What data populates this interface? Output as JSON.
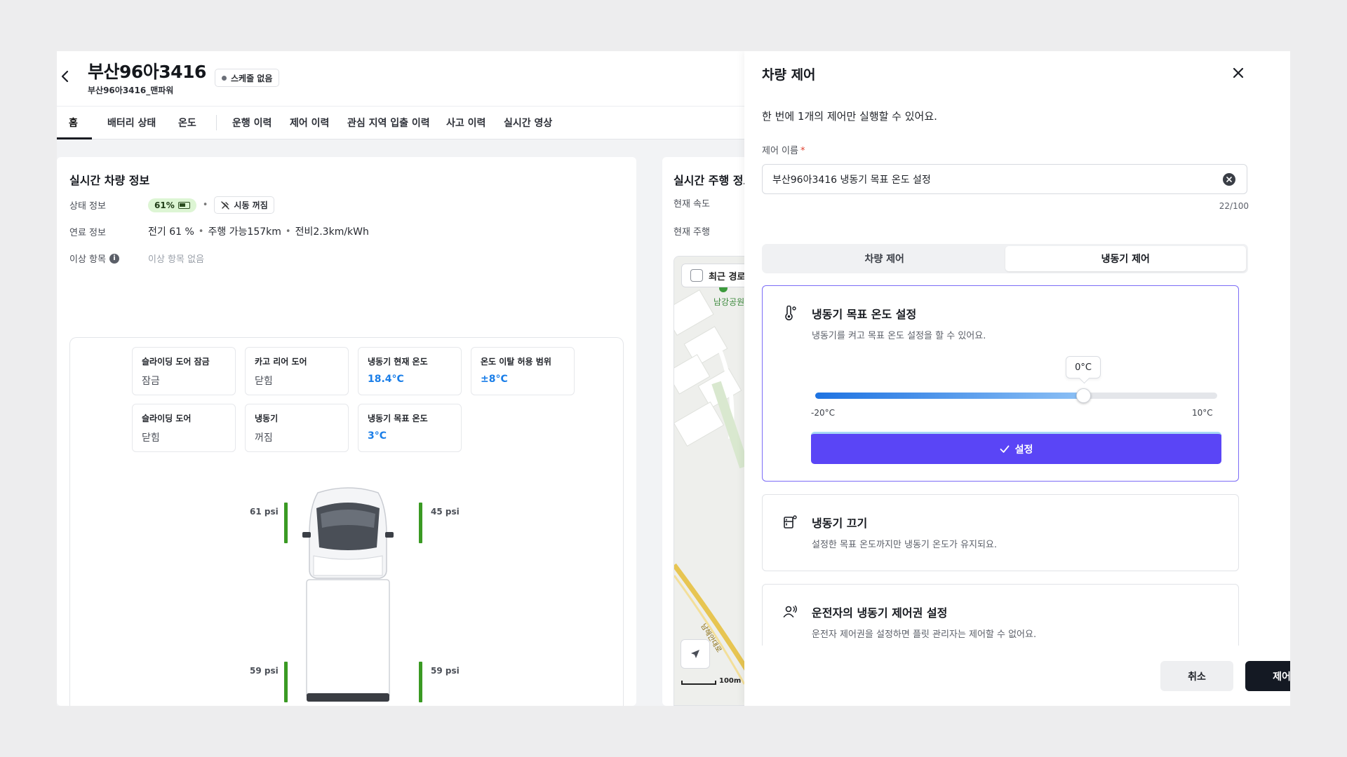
{
  "header": {
    "plate": "부산96아3416",
    "subtitle": "부산96아3416_맨파워",
    "schedule_badge": "스케줄 없음"
  },
  "tabs": [
    {
      "label": "홈",
      "active": true
    },
    {
      "label": "배터리 상태"
    },
    {
      "label": "온도"
    },
    {
      "label": "운행 이력"
    },
    {
      "label": "제어 이력"
    },
    {
      "label": "관심 지역 입출 이력"
    },
    {
      "label": "사고 이력"
    },
    {
      "label": "실시간 영상"
    }
  ],
  "realtime_vehicle": {
    "title": "실시간 차량 정보",
    "status_label": "상태 정보",
    "battery_pct": "61%",
    "ignition": "시동 꺼짐",
    "fuel_label": "연료 정보",
    "fuel_electric": "전기 61 %",
    "fuel_range": "주행 가능157km",
    "fuel_efficiency": "전비2.3km/kWh",
    "abnormal_label": "이상 항목",
    "abnormal_value": "이상 항목 없음",
    "stats": [
      {
        "label": "슬라이딩 도어 잠금",
        "value": "잠금"
      },
      {
        "label": "카고 리어 도어",
        "value": "닫힘"
      },
      {
        "label": "냉동기 현재 온도",
        "value": "18.4°C",
        "highlight": true
      },
      {
        "label": "온도 이탈 허용 범위",
        "value": "±8°C",
        "highlight": true
      },
      {
        "label": "슬라이딩 도어",
        "value": "닫힘"
      },
      {
        "label": "냉동기",
        "value": "꺼짐"
      },
      {
        "label": "냉동기 목표 온도",
        "value": "3°C",
        "highlight": true
      }
    ],
    "tires": {
      "front_left": "61 psi",
      "front_right": "45 psi",
      "rear_left": "59 psi",
      "rear_right": "59 psi"
    }
  },
  "realtime_driving": {
    "title": "실시간 주행 정보",
    "speed_label": "현재 속도",
    "driving_label": "현재 주행",
    "map_chip": "최근 경로",
    "map_place": "남강공원",
    "map_road": "남해안대로",
    "scale": "100m"
  },
  "drawer": {
    "title": "차량 제어",
    "description": "한 번에 1개의 제어만 실행할 수 있어요.",
    "name_label": "제어 이름",
    "name_value": "부산96아3416 냉동기 목표 온도 설정",
    "counter": "22/100",
    "segments": [
      {
        "label": "차량 제어"
      },
      {
        "label": "냉동기 제어",
        "active": true
      }
    ],
    "options": [
      {
        "title": "냉동기 목표 온도 설정",
        "desc": "냉동기를 켜고 목표 온도 설정을 할 수 있어요.",
        "icon": "thermometer-icon",
        "selected": true
      },
      {
        "title": "냉동기 끄기",
        "desc": "설정한 목표 온도까지만 냉동기 온도가 유지되요.",
        "icon": "freezer-off-icon"
      },
      {
        "title": "운전자의 냉동기 제어권 설정",
        "desc": "운전자 제어권을 설정하면 플릿 관리자는 제어할 수 없어요.",
        "icon": "driver-permission-icon"
      }
    ],
    "slider": {
      "value_label": "0°C",
      "min_label": "-20°C",
      "max_label": "10°C",
      "value": 0,
      "min": -20,
      "max": 10
    },
    "set_button": "설정",
    "cancel": "취소",
    "submit": "제어"
  },
  "colors": {
    "accent": "#5a45f6",
    "selected_border": "#7b6cf6",
    "temp_blue": "#1a7ee8",
    "tire_green": "#3a9a23",
    "submit_bg": "#141923"
  }
}
